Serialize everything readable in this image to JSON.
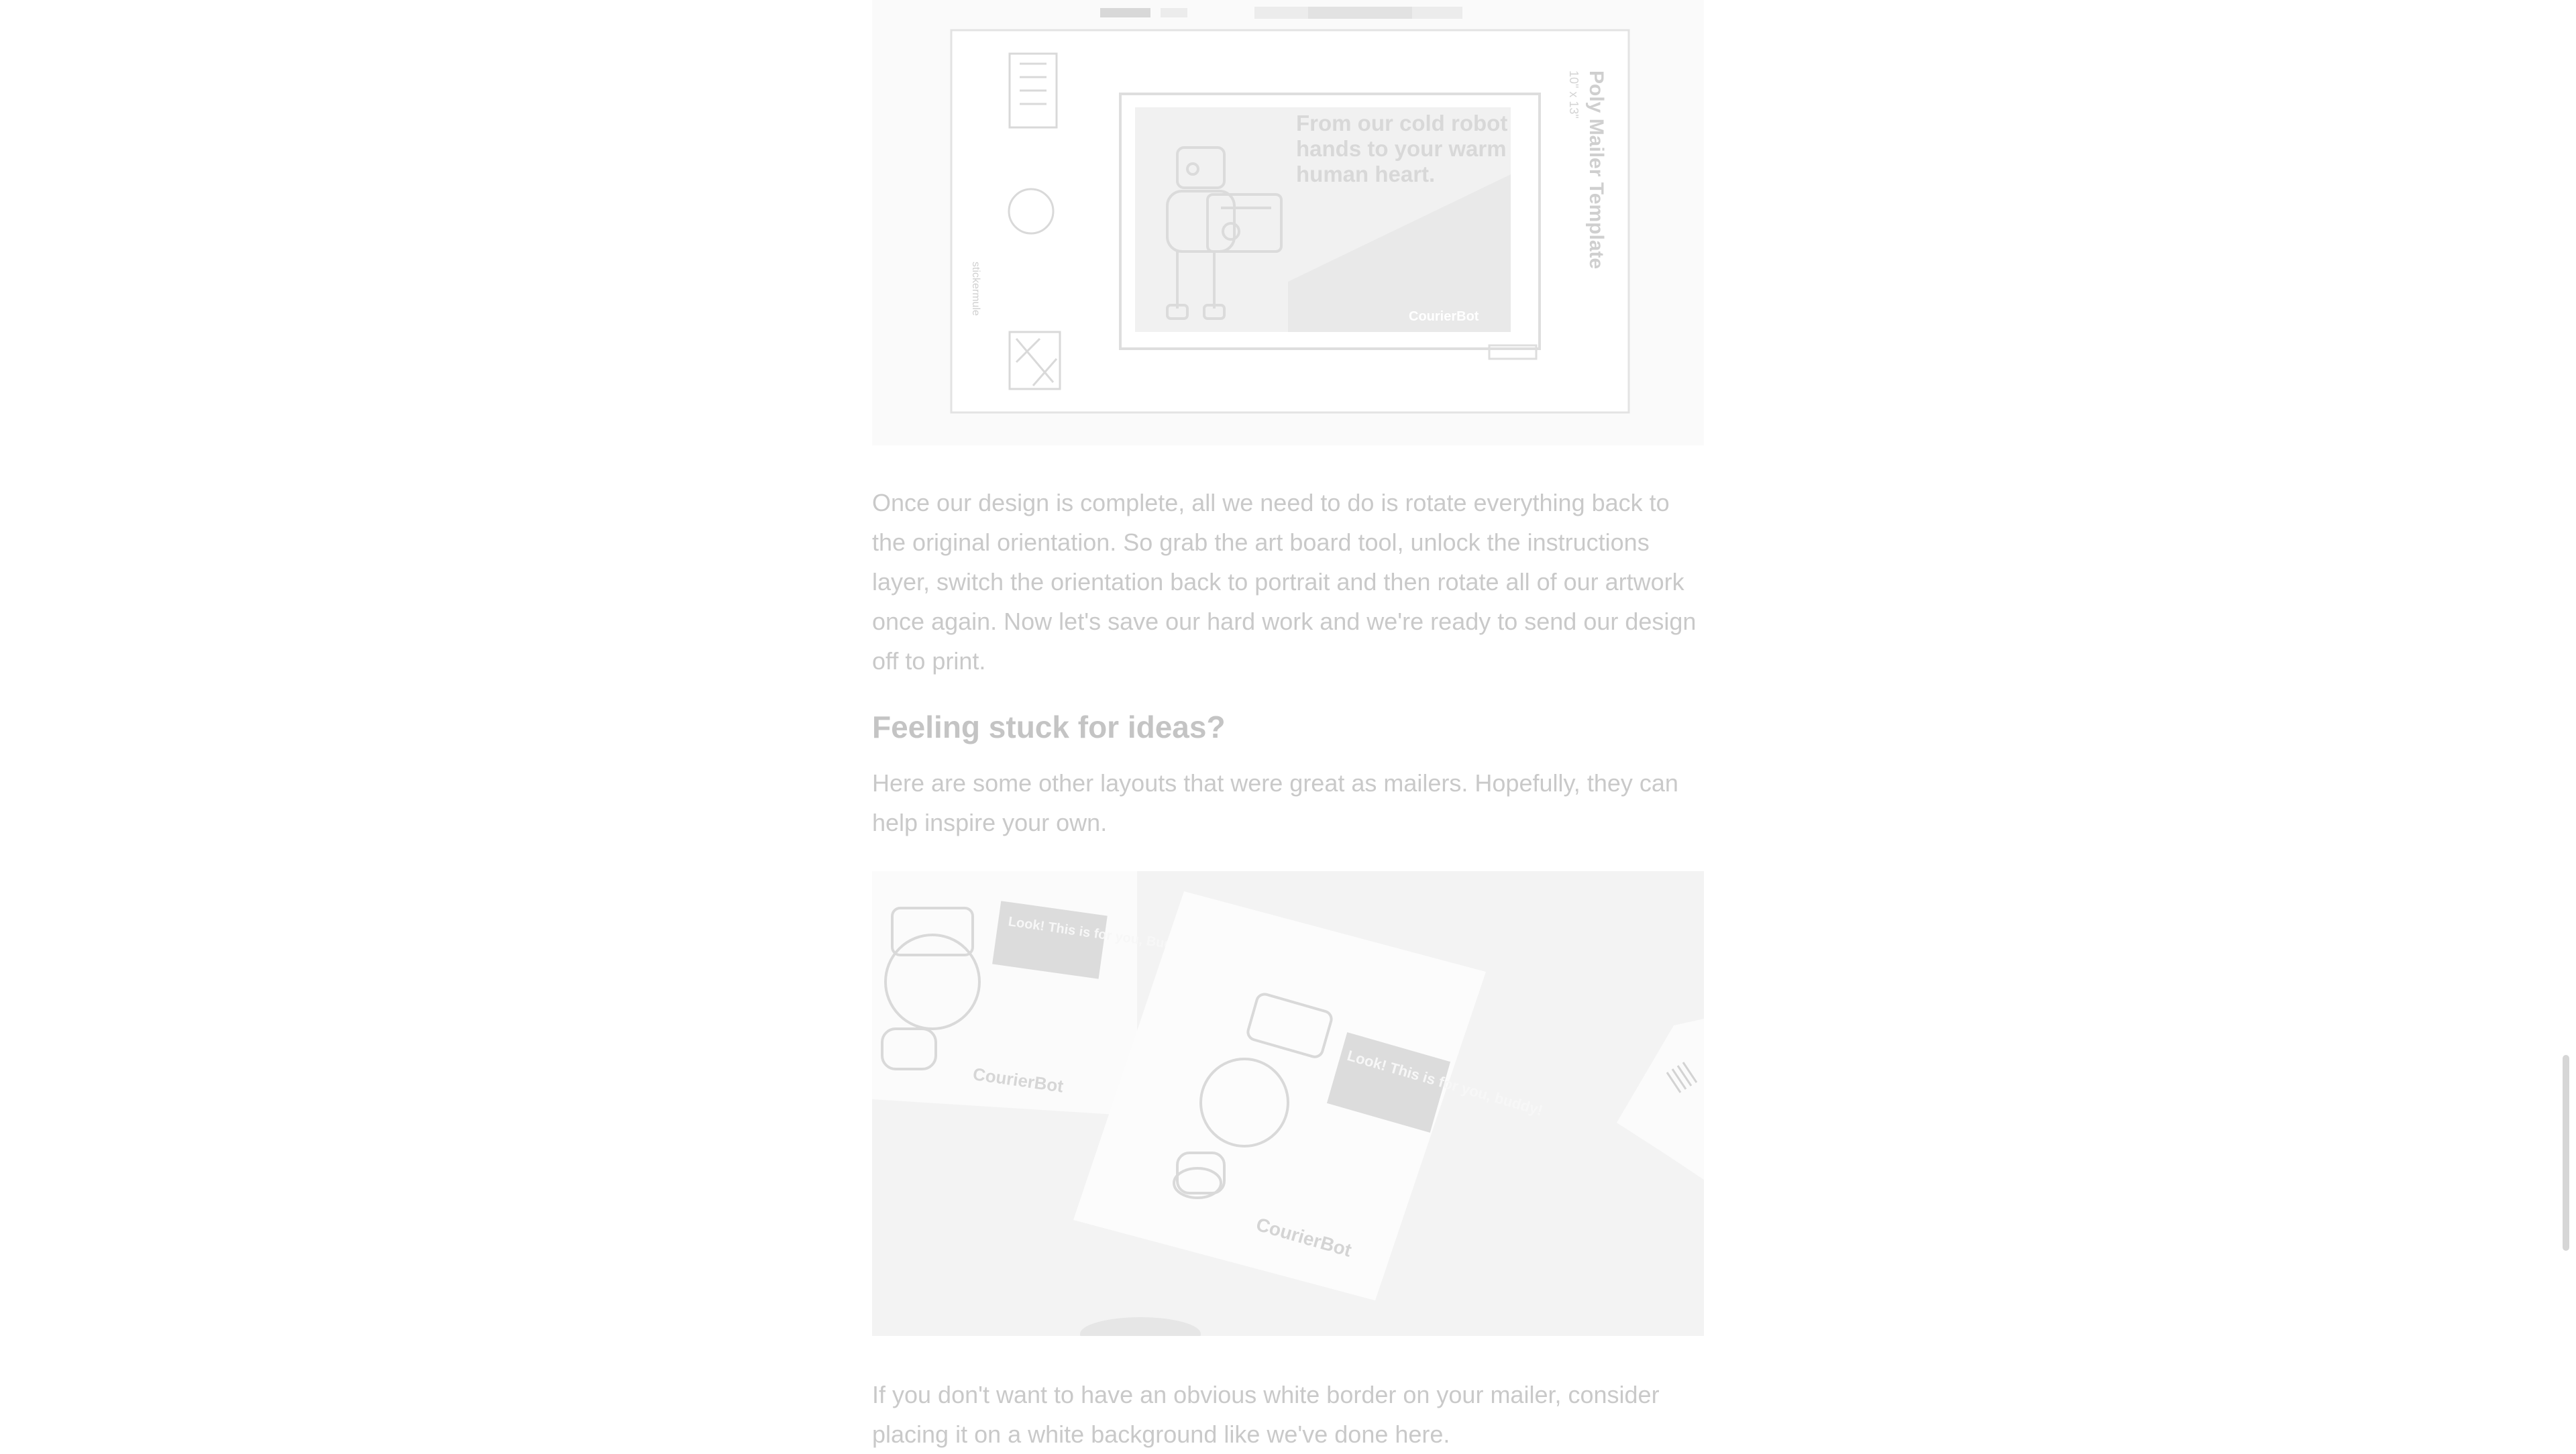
{
  "article": {
    "paragraph_1": "Once our design is complete, all we need to do is rotate everything back to the original orientation. So grab the art board tool, unlock the instructions layer, switch the orientation back to portrait and then rotate all of our artwork once again. Now let's save our hard work and we're ready to send our design off to print.",
    "heading": "Feeling stuck for ideas?",
    "paragraph_2": "Here are some other layouts that were great as mailers. Hopefully, they can help inspire your own.",
    "paragraph_3": "If you don't want to have an obvious white border on your mailer, consider placing it on a white background like we've done here."
  },
  "figure_1": {
    "template_title": "Poly Mailer Template",
    "template_size": "10\" x 13\"",
    "brand": "stickermule",
    "headline_line_1": "From our cold robot",
    "headline_line_2": "hands to your warm",
    "headline_line_3": "human heart.",
    "footer_brand": "CourierBot"
  },
  "figure_2": {
    "brand_left": "CourierBot",
    "brand_center": "CourierBot",
    "speech_left": "Look! This is for you, Buddy.",
    "speech_center": "Look! This is for you, buddy!"
  },
  "colors": {
    "text": "#c9c9c9",
    "heading": "#c4c4c4",
    "figure_bg": "#fafafa",
    "photo_bg": "#f2f2f2"
  }
}
